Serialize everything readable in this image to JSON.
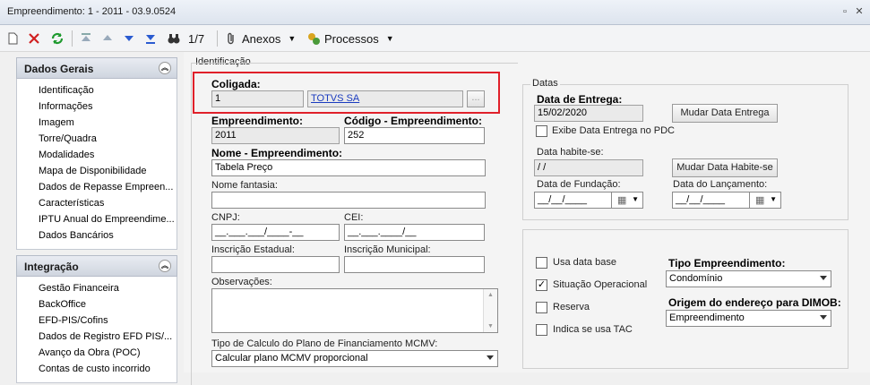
{
  "window": {
    "title": "Empreendimento: 1 - 2011 - 03.9.0524"
  },
  "toolbar": {
    "record_counter": "1/7",
    "anexos_label": "Anexos",
    "processos_label": "Processos"
  },
  "sidebar": {
    "dados_gerais": {
      "title": "Dados Gerais",
      "items": [
        "Identificação",
        "Informações",
        "Imagem",
        "Torre/Quadra",
        "Modalidades",
        "Mapa de Disponibilidade",
        "Dados de Repasse Empreen...",
        "Características",
        "IPTU Anual do Empreendime...",
        "Dados Bancários"
      ]
    },
    "integracao": {
      "title": "Integração",
      "items": [
        "Gestão Financeira",
        "BackOffice",
        "EFD-PIS/Cofins",
        "Dados de Registro EFD PIS/...",
        "Avanço da Obra (POC)",
        "Contas de custo incorrido"
      ]
    }
  },
  "form": {
    "section_title": "Identificação",
    "coligada_label": "Coligada:",
    "coligada_code": "1",
    "coligada_name": "TOTVS SA",
    "coligada_lookup": "...",
    "empreendimento_label": "Empreendimento:",
    "empreendimento_value": "2011",
    "codigo_label": "Código - Empreendimento:",
    "codigo_value": "252",
    "nome_label": "Nome - Empreendimento:",
    "nome_value": "Tabela Preço",
    "fantasia_label": "Nome fantasia:",
    "fantasia_value": "",
    "cnpj_label": "CNPJ:",
    "cnpj_value": "__.___.___/____-__",
    "cei_label": "CEI:",
    "cei_value": "__.___.____/__",
    "ie_label": "Inscrição Estadual:",
    "im_label": "Inscrição Municipal:",
    "obs_label": "Observações:",
    "calculo_label": "Tipo de Calculo do Plano de Financiamento MCMV:",
    "calculo_value": "Calcular plano MCMV proporcional"
  },
  "datas": {
    "title": "Datas",
    "entrega_label": "Data de Entrega:",
    "entrega_value": "15/02/2020",
    "mudar_entrega": "Mudar Data Entrega",
    "exibe_label": "Exibe Data Entrega no PDC",
    "habite_label": "Data habite-se:",
    "habite_value": "/ /",
    "mudar_habite": "Mudar Data Habite-se",
    "fundacao_label": "Data de Fundação:",
    "fundacao_value": "__/__/____",
    "lancamento_label": "Data do Lançamento:",
    "lancamento_value": "__/__/____"
  },
  "opcoes": {
    "usa_base": "Usa data base",
    "situacao": "Situação Operacional",
    "reserva": "Reserva",
    "tac": "Indica se usa TAC",
    "tipo_label": "Tipo Empreendimento:",
    "tipo_value": "Condomínio",
    "origem_label": "Origem do endereço para DIMOB:",
    "origem_value": "Empreendimento"
  },
  "colors": {
    "highlight": "#e0202a",
    "link": "#1a3bbf"
  }
}
